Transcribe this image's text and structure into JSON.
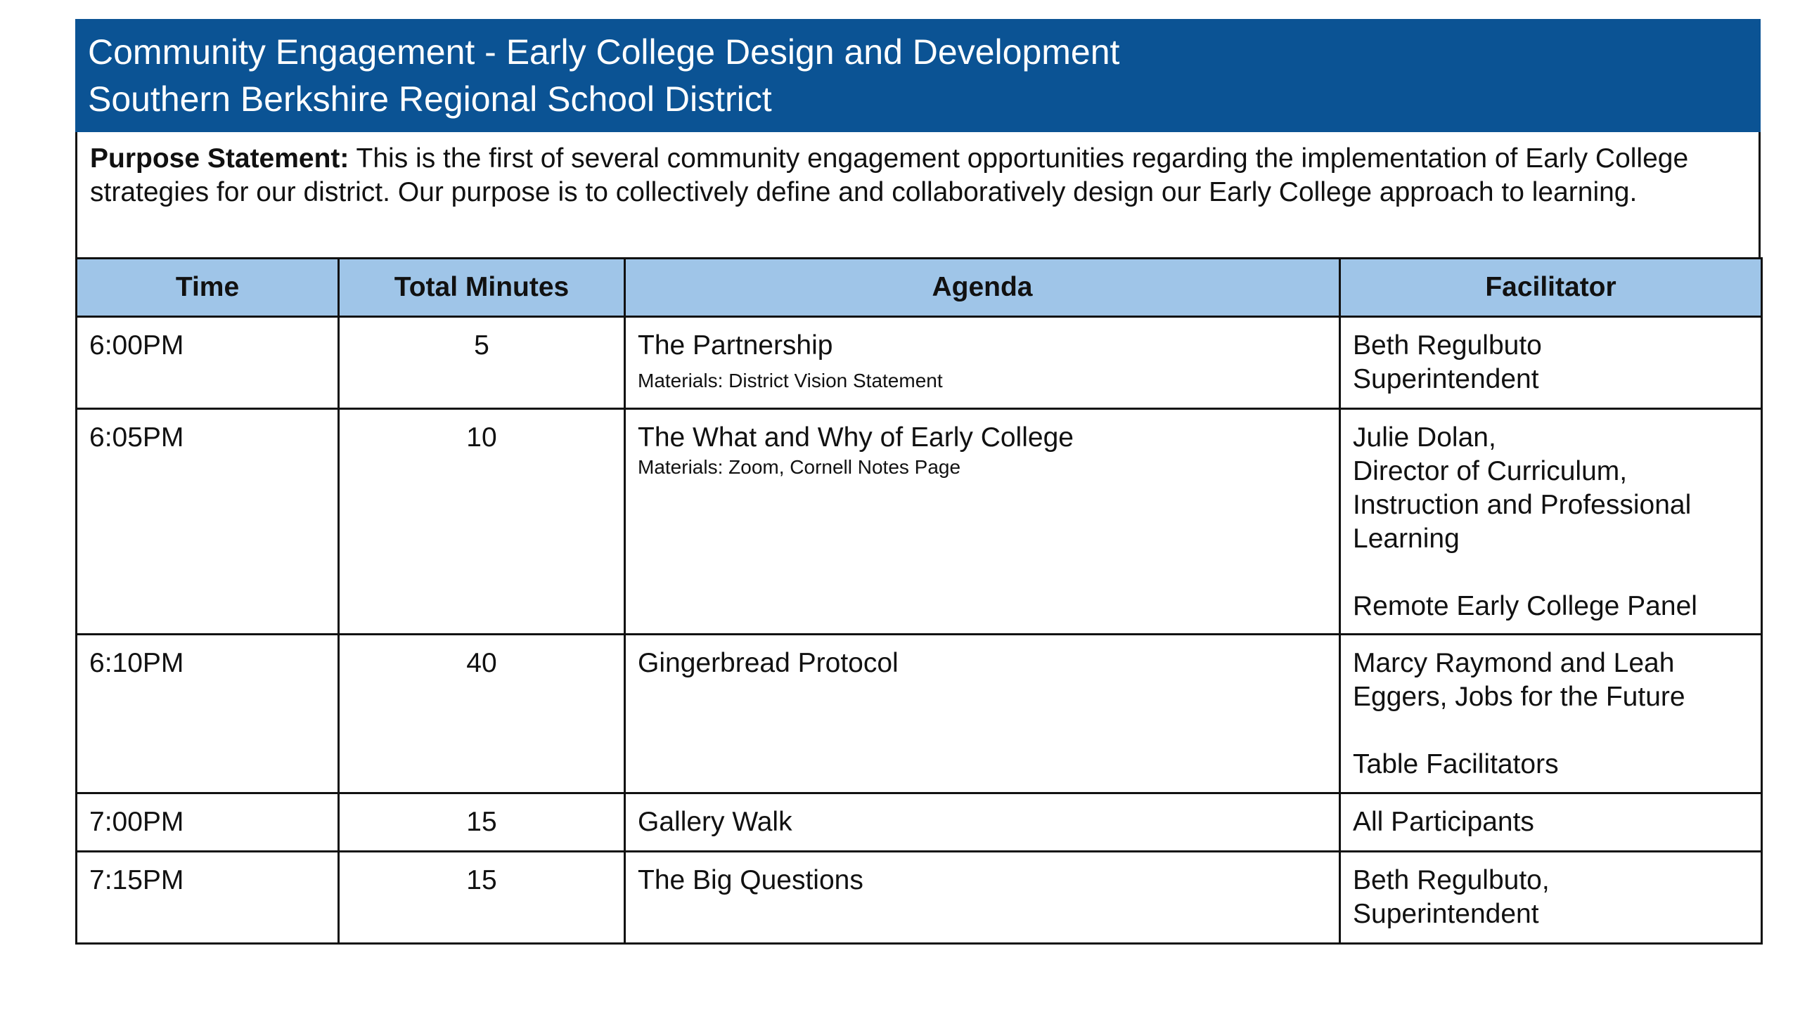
{
  "header": {
    "title_line1": "Community Engagement - Early College Design and Development",
    "title_line2": "Southern Berkshire Regional School District",
    "background_color": "#0b5394"
  },
  "purpose": {
    "label": "Purpose Statement:",
    "text": "This is the first of several community engagement opportunities regarding the implementation of Early College strategies for our district.  Our purpose is to collectively define and collaboratively design our Early College approach to learning."
  },
  "table": {
    "header_color": "#9fc5e8",
    "columns": [
      "Time",
      "Total Minutes",
      "Agenda",
      "Facilitator"
    ],
    "rows": [
      {
        "time": "6:00PM",
        "minutes": "5",
        "agenda": "The Partnership",
        "materials": "Materials:  District Vision Statement",
        "facilitator": [
          "Beth Regulbuto",
          "Superintendent"
        ],
        "facilitator2": []
      },
      {
        "time": "6:05PM",
        "minutes": "10",
        "agenda": "The What and Why of Early College",
        "materials": "Materials:  Zoom, Cornell  Notes Page",
        "facilitator": [
          "Julie Dolan,",
          "Director of Curriculum,",
          "Instruction and Professional",
          "Learning"
        ],
        "facilitator2": [
          "Remote Early College Panel"
        ]
      },
      {
        "time": "6:10PM",
        "minutes": "40",
        "agenda": "Gingerbread Protocol",
        "materials": "",
        "facilitator": [
          "Marcy Raymond and Leah",
          "Eggers, Jobs for the Future"
        ],
        "facilitator2": [
          "Table Facilitators"
        ]
      },
      {
        "time": "7:00PM",
        "minutes": "15",
        "agenda": "Gallery Walk",
        "materials": "",
        "facilitator": [
          "All Participants"
        ],
        "facilitator2": []
      },
      {
        "time": "7:15PM",
        "minutes": "15",
        "agenda": "The Big Questions",
        "materials": "",
        "facilitator": [
          "Beth Regulbuto,",
          "Superintendent"
        ],
        "facilitator2": []
      }
    ]
  }
}
